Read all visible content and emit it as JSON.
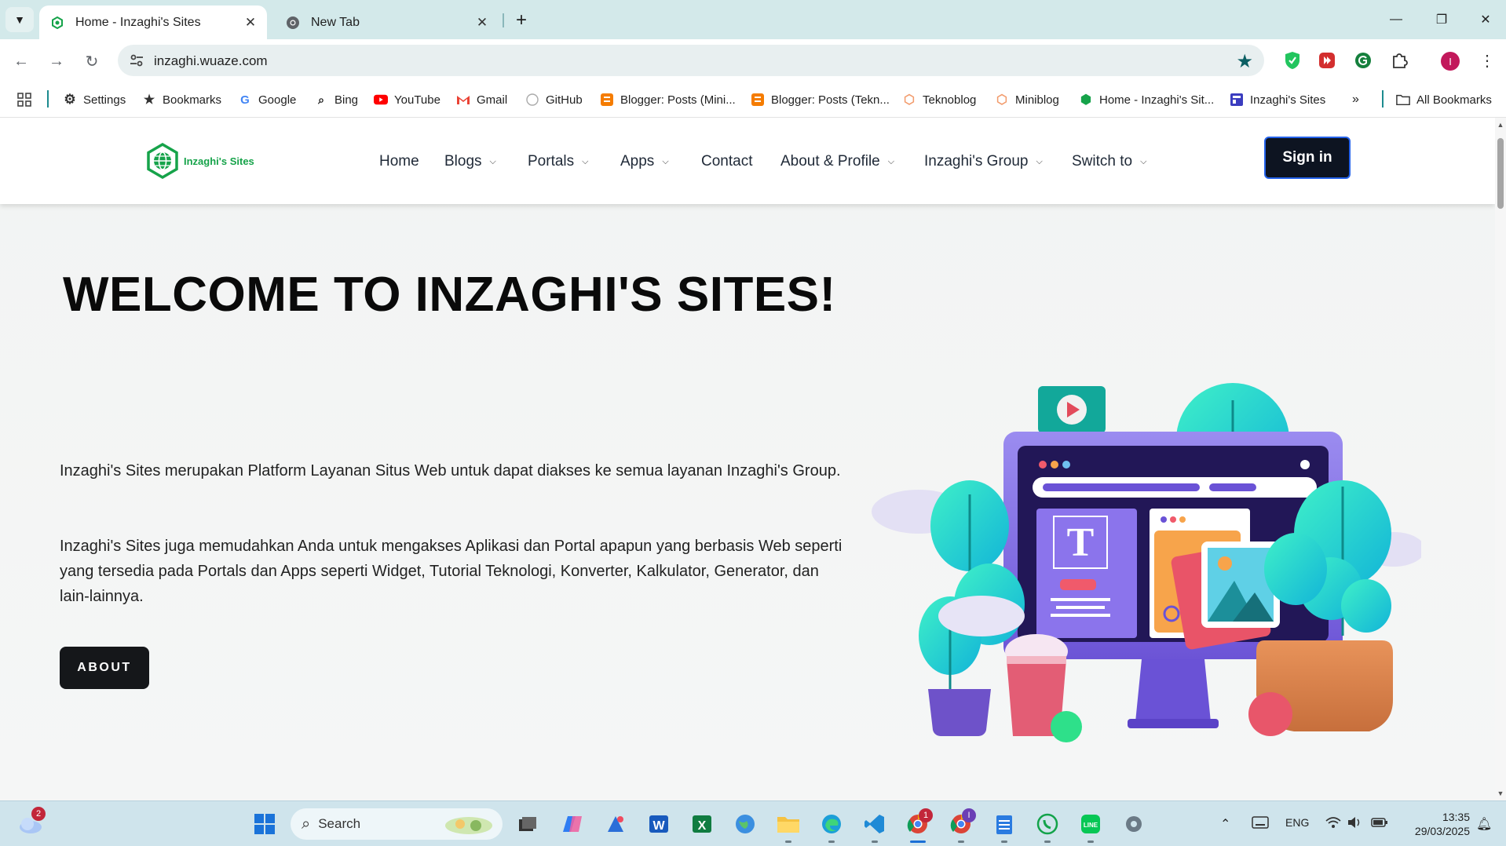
{
  "browser": {
    "tabs": [
      {
        "title": "Home - Inzaghi's Sites",
        "active": true
      },
      {
        "title": "New Tab",
        "active": false
      }
    ],
    "url": "inzaghi.wuaze.com",
    "profile_initial": "I",
    "bookmarks": [
      {
        "label": "Settings",
        "icon": "gear-icon"
      },
      {
        "label": "Bookmarks",
        "icon": "star-icon"
      },
      {
        "label": "Google",
        "icon": "google-icon"
      },
      {
        "label": "Bing",
        "icon": "search-icon"
      },
      {
        "label": "YouTube",
        "icon": "youtube-icon"
      },
      {
        "label": "Gmail",
        "icon": "gmail-icon"
      },
      {
        "label": "GitHub",
        "icon": "github-icon"
      },
      {
        "label": "Blogger: Posts (Mini...",
        "icon": "blogger-icon"
      },
      {
        "label": "Blogger: Posts (Tekn...",
        "icon": "blogger-icon"
      },
      {
        "label": "Teknoblog",
        "icon": "hexagon-icon"
      },
      {
        "label": "Miniblog",
        "icon": "hexagon-icon"
      },
      {
        "label": "Home - Inzaghi's Sit...",
        "icon": "globe-icon"
      },
      {
        "label": "Inzaghi's Sites",
        "icon": "site-icon"
      }
    ],
    "all_bookmarks": "All Bookmarks"
  },
  "site": {
    "logo_text": "Inzaghi's Sites",
    "nav": [
      {
        "label": "Home",
        "dropdown": false
      },
      {
        "label": "Blogs",
        "dropdown": true
      },
      {
        "label": "Portals",
        "dropdown": true
      },
      {
        "label": "Apps",
        "dropdown": true
      },
      {
        "label": "Contact",
        "dropdown": false
      },
      {
        "label": "About & Profile",
        "dropdown": true
      },
      {
        "label": "Inzaghi's Group",
        "dropdown": true
      },
      {
        "label": "Switch to",
        "dropdown": true
      }
    ],
    "signin": "Sign in",
    "hero": {
      "title": "WELCOME TO INZAGHI'S SITES!",
      "paragraph1": "Inzaghi's Sites merupakan Platform Layanan Situs Web untuk dapat diakses ke semua layanan Inzaghi's Group.",
      "paragraph2": "Inzaghi's Sites juga memudahkan Anda untuk mengakses Aplikasi dan Portal apapun yang berbasis Web seperti yang tersedia pada Portals dan Apps seperti Widget, Tutorial Teknologi, Konverter, Kalkulator, Generator, dan lain-lainnya.",
      "button": "ABOUT"
    }
  },
  "taskbar": {
    "weather_badge": "2",
    "search_placeholder": "Search",
    "chrome_badge": "1",
    "chrome2_badge": "I",
    "language": "ENG",
    "time": "13:35",
    "date": "29/03/2025"
  },
  "colors": {
    "tabstrip": "#d3e9ea",
    "brand_green": "#16a34a",
    "signin_bg": "#0d1421",
    "signin_border": "#2563eb",
    "taskbar": "#cfe4ec"
  }
}
